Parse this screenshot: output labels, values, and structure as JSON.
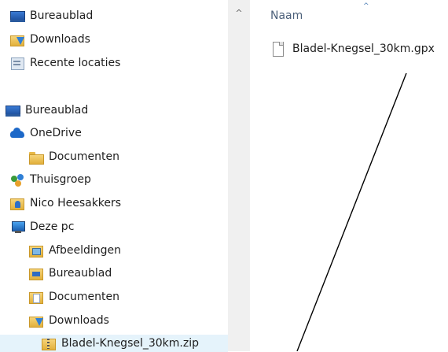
{
  "navigation": {
    "items": [
      {
        "label": "Bureaublad",
        "icon": "desktop-icon"
      },
      {
        "label": "Downloads",
        "icon": "downloads-folder-icon"
      },
      {
        "label": "Recente locaties",
        "icon": "recent-locations-icon"
      },
      {
        "label": "Bureaublad",
        "icon": "desktop-icon"
      },
      {
        "label": "OneDrive",
        "icon": "onedrive-cloud-icon"
      },
      {
        "label": "Documenten",
        "icon": "folder-icon"
      },
      {
        "label": "Thuisgroep",
        "icon": "homegroup-icon"
      },
      {
        "label": "Nico Heesakkers",
        "icon": "user-folder-icon"
      },
      {
        "label": "Deze pc",
        "icon": "this-pc-icon"
      },
      {
        "label": "Afbeeldingen",
        "icon": "pictures-folder-icon"
      },
      {
        "label": "Bureaublad",
        "icon": "desktop-folder-icon"
      },
      {
        "label": "Documenten",
        "icon": "documents-folder-icon"
      },
      {
        "label": "Downloads",
        "icon": "downloads-folder-icon"
      },
      {
        "label": "Bladel-Knegsel_30km.zip",
        "icon": "zip-folder-icon"
      }
    ]
  },
  "content": {
    "column_header": "Naam",
    "sort_indicator": "^",
    "files": [
      {
        "name": "Bladel-Knegsel_30km.gpx",
        "icon": "file-icon"
      }
    ]
  },
  "scrollbar": {
    "up_arrow": "^"
  }
}
